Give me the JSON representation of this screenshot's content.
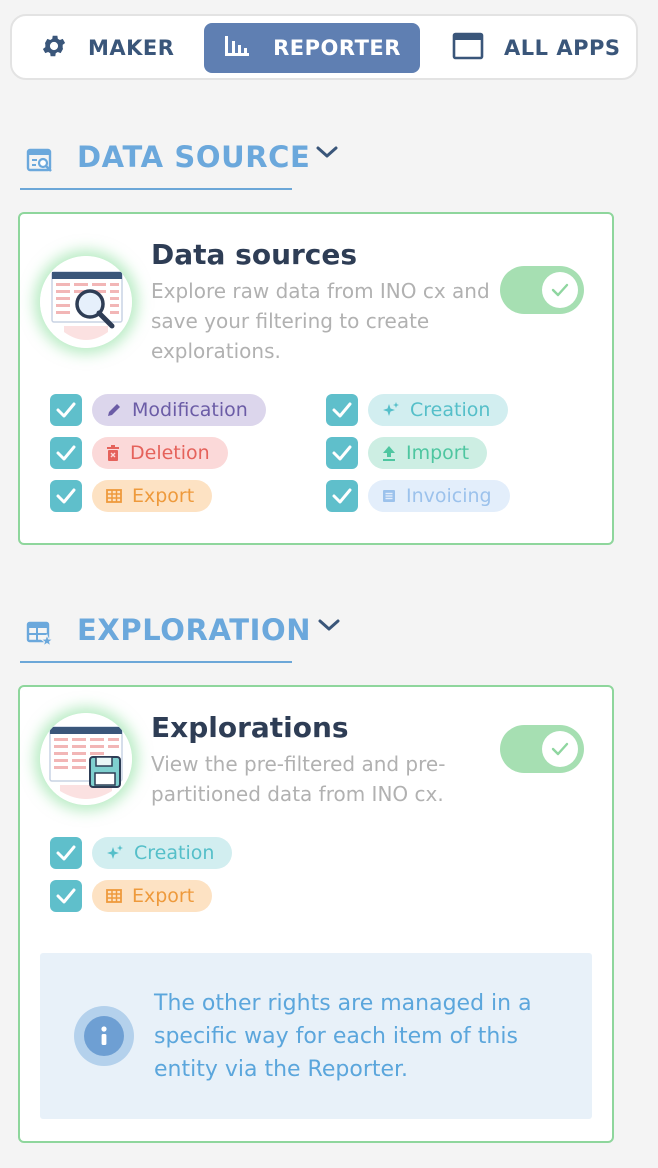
{
  "nav": {
    "tabs": [
      {
        "label": "MAKER",
        "icon": "gear-icon",
        "active": false
      },
      {
        "label": "REPORTER",
        "icon": "bar-chart-icon",
        "active": true
      },
      {
        "label": "ALL APPS",
        "icon": "window-icon",
        "active": false
      }
    ]
  },
  "sections": [
    {
      "title": "DATA SOURCE",
      "icon": "data-source-search-icon",
      "card": {
        "title": "Data sources",
        "description": "Explore raw data from INO cx and save your filtering to create explorations.",
        "illustration": "spreadsheet-magnifier-illustration",
        "enabled": true,
        "permissions": [
          {
            "label": "Modification",
            "icon": "pencil-icon",
            "checked": true,
            "color": "#6b5ca6"
          },
          {
            "label": "Creation",
            "icon": "sparkle-icon",
            "checked": true,
            "color": "#55bfc9"
          },
          {
            "label": "Deletion",
            "icon": "trash-icon",
            "checked": true,
            "color": "#e5625b"
          },
          {
            "label": "Import",
            "icon": "upload-icon",
            "checked": true,
            "color": "#4ec6a0"
          },
          {
            "label": "Export",
            "icon": "table-icon",
            "checked": true,
            "color": "#ee9a3c"
          },
          {
            "label": "Invoicing",
            "icon": "list-icon",
            "checked": true,
            "color": "#9cc2ec"
          }
        ]
      }
    },
    {
      "title": "EXPLORATION",
      "icon": "table-star-icon",
      "card": {
        "title": "Explorations",
        "description": "View the pre-filtered and pre-partitioned data from INO cx.",
        "illustration": "spreadsheet-save-illustration",
        "enabled": true,
        "permissions": [
          {
            "label": "Creation",
            "icon": "sparkle-icon",
            "checked": true,
            "color": "#55bfc9"
          },
          {
            "label": "Export",
            "icon": "table-icon",
            "checked": true,
            "color": "#ee9a3c"
          }
        ],
        "info": "The other rights are managed in a specific way for each item of this entity via the Reporter."
      }
    }
  ],
  "colors": {
    "accent": "#5f7fb2",
    "section_title": "#6ba8dc",
    "card_border": "#8ed69c",
    "checkbox": "#5fbfcb",
    "toggle_on": "#a6dfb2"
  }
}
